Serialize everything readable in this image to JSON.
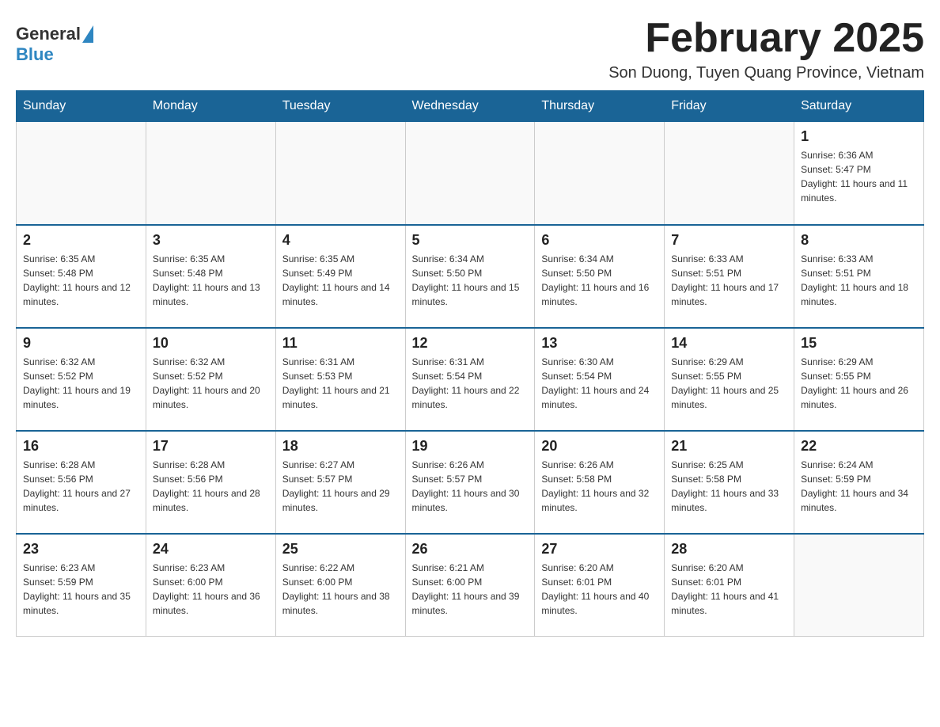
{
  "header": {
    "logo_general": "General",
    "logo_blue": "Blue",
    "month_title": "February 2025",
    "subtitle": "Son Duong, Tuyen Quang Province, Vietnam"
  },
  "days_of_week": [
    "Sunday",
    "Monday",
    "Tuesday",
    "Wednesday",
    "Thursday",
    "Friday",
    "Saturday"
  ],
  "weeks": [
    [
      {
        "day": "",
        "info": ""
      },
      {
        "day": "",
        "info": ""
      },
      {
        "day": "",
        "info": ""
      },
      {
        "day": "",
        "info": ""
      },
      {
        "day": "",
        "info": ""
      },
      {
        "day": "",
        "info": ""
      },
      {
        "day": "1",
        "info": "Sunrise: 6:36 AM\nSunset: 5:47 PM\nDaylight: 11 hours and 11 minutes."
      }
    ],
    [
      {
        "day": "2",
        "info": "Sunrise: 6:35 AM\nSunset: 5:48 PM\nDaylight: 11 hours and 12 minutes."
      },
      {
        "day": "3",
        "info": "Sunrise: 6:35 AM\nSunset: 5:48 PM\nDaylight: 11 hours and 13 minutes."
      },
      {
        "day": "4",
        "info": "Sunrise: 6:35 AM\nSunset: 5:49 PM\nDaylight: 11 hours and 14 minutes."
      },
      {
        "day": "5",
        "info": "Sunrise: 6:34 AM\nSunset: 5:50 PM\nDaylight: 11 hours and 15 minutes."
      },
      {
        "day": "6",
        "info": "Sunrise: 6:34 AM\nSunset: 5:50 PM\nDaylight: 11 hours and 16 minutes."
      },
      {
        "day": "7",
        "info": "Sunrise: 6:33 AM\nSunset: 5:51 PM\nDaylight: 11 hours and 17 minutes."
      },
      {
        "day": "8",
        "info": "Sunrise: 6:33 AM\nSunset: 5:51 PM\nDaylight: 11 hours and 18 minutes."
      }
    ],
    [
      {
        "day": "9",
        "info": "Sunrise: 6:32 AM\nSunset: 5:52 PM\nDaylight: 11 hours and 19 minutes."
      },
      {
        "day": "10",
        "info": "Sunrise: 6:32 AM\nSunset: 5:52 PM\nDaylight: 11 hours and 20 minutes."
      },
      {
        "day": "11",
        "info": "Sunrise: 6:31 AM\nSunset: 5:53 PM\nDaylight: 11 hours and 21 minutes."
      },
      {
        "day": "12",
        "info": "Sunrise: 6:31 AM\nSunset: 5:54 PM\nDaylight: 11 hours and 22 minutes."
      },
      {
        "day": "13",
        "info": "Sunrise: 6:30 AM\nSunset: 5:54 PM\nDaylight: 11 hours and 24 minutes."
      },
      {
        "day": "14",
        "info": "Sunrise: 6:29 AM\nSunset: 5:55 PM\nDaylight: 11 hours and 25 minutes."
      },
      {
        "day": "15",
        "info": "Sunrise: 6:29 AM\nSunset: 5:55 PM\nDaylight: 11 hours and 26 minutes."
      }
    ],
    [
      {
        "day": "16",
        "info": "Sunrise: 6:28 AM\nSunset: 5:56 PM\nDaylight: 11 hours and 27 minutes."
      },
      {
        "day": "17",
        "info": "Sunrise: 6:28 AM\nSunset: 5:56 PM\nDaylight: 11 hours and 28 minutes."
      },
      {
        "day": "18",
        "info": "Sunrise: 6:27 AM\nSunset: 5:57 PM\nDaylight: 11 hours and 29 minutes."
      },
      {
        "day": "19",
        "info": "Sunrise: 6:26 AM\nSunset: 5:57 PM\nDaylight: 11 hours and 30 minutes."
      },
      {
        "day": "20",
        "info": "Sunrise: 6:26 AM\nSunset: 5:58 PM\nDaylight: 11 hours and 32 minutes."
      },
      {
        "day": "21",
        "info": "Sunrise: 6:25 AM\nSunset: 5:58 PM\nDaylight: 11 hours and 33 minutes."
      },
      {
        "day": "22",
        "info": "Sunrise: 6:24 AM\nSunset: 5:59 PM\nDaylight: 11 hours and 34 minutes."
      }
    ],
    [
      {
        "day": "23",
        "info": "Sunrise: 6:23 AM\nSunset: 5:59 PM\nDaylight: 11 hours and 35 minutes."
      },
      {
        "day": "24",
        "info": "Sunrise: 6:23 AM\nSunset: 6:00 PM\nDaylight: 11 hours and 36 minutes."
      },
      {
        "day": "25",
        "info": "Sunrise: 6:22 AM\nSunset: 6:00 PM\nDaylight: 11 hours and 38 minutes."
      },
      {
        "day": "26",
        "info": "Sunrise: 6:21 AM\nSunset: 6:00 PM\nDaylight: 11 hours and 39 minutes."
      },
      {
        "day": "27",
        "info": "Sunrise: 6:20 AM\nSunset: 6:01 PM\nDaylight: 11 hours and 40 minutes."
      },
      {
        "day": "28",
        "info": "Sunrise: 6:20 AM\nSunset: 6:01 PM\nDaylight: 11 hours and 41 minutes."
      },
      {
        "day": "",
        "info": ""
      }
    ]
  ]
}
